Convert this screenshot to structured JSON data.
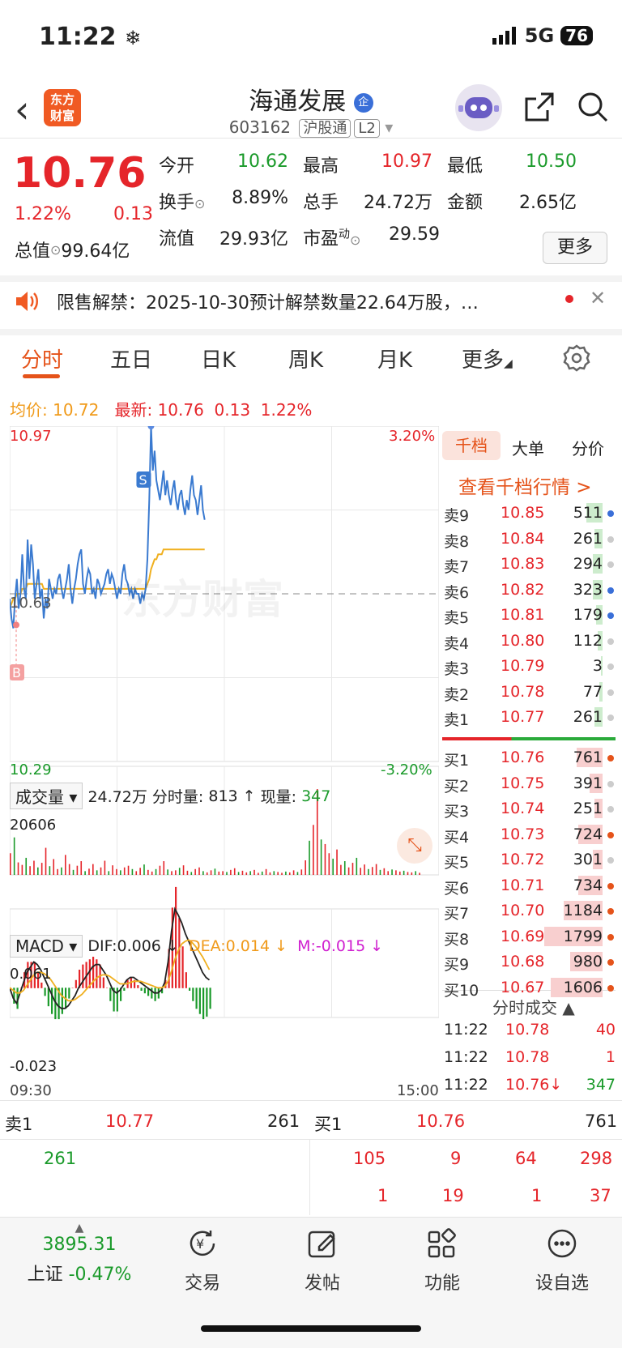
{
  "status": {
    "time": "11:22",
    "network": "5G",
    "battery": "76"
  },
  "header": {
    "logo_line1": "东方",
    "logo_line2": "财富",
    "name": "海通发展",
    "name_badge": "企",
    "code": "603162",
    "tag1": "沪股通",
    "tag2": "L2"
  },
  "quote": {
    "price": "10.76",
    "chg_pct": "1.22%",
    "chg_amt": "0.13",
    "open_label": "今开",
    "open": "10.62",
    "high_label": "最高",
    "high": "10.97",
    "low_label": "最低",
    "low": "10.50",
    "turnover_label": "换手",
    "turnover": "8.89%",
    "volume_label": "总手",
    "volume": "24.72万",
    "amount_label": "金额",
    "amount": "2.65亿",
    "total_val_label": "总值",
    "total_val": "99.64亿",
    "float_val_label": "流值",
    "float_val": "29.93亿",
    "pe_label": "市盈",
    "pe_sup": "动",
    "pe": "29.59",
    "more": "更多"
  },
  "notice": {
    "text": "限售解禁：2025-10-30预计解禁数量22.64万股，…"
  },
  "tabs": [
    "分时",
    "五日",
    "日K",
    "周K",
    "月K",
    "更多"
  ],
  "avg_bar": {
    "avg_label": "均价:",
    "avg": "10.72",
    "latest_label": "最新:",
    "latest": "10.76",
    "chg": "0.13",
    "pct": "1.22%"
  },
  "chart": {
    "price_high": "10.97",
    "price_low": "10.29",
    "pct_high": "3.20%",
    "pct_low": "-3.20%",
    "base_price": "10.63",
    "watermark": "东方财富",
    "b_marker": "B",
    "s_marker": "S",
    "time_start": "09:30",
    "time_end": "15:00"
  },
  "volume_bar": {
    "label": "成交量",
    "total": "24.72万",
    "tick_label": "分时量:",
    "tick": "813",
    "now_label": "现量:",
    "now": "347",
    "max": "20606"
  },
  "macd_bar": {
    "label": "MACD",
    "dif": "DIF:0.006 ↓",
    "dea": "DEA:0.014 ↓",
    "m": "M:-0.015 ↓",
    "max": "0.061",
    "min": "-0.023"
  },
  "book_tabs": [
    "千档",
    "大单",
    "分价"
  ],
  "book_link": "查看千档行情 >",
  "asks": [
    {
      "label": "卖9",
      "price": "10.85",
      "vol": "511",
      "bar": 0.1,
      "dot": "#3a6fd8"
    },
    {
      "label": "卖8",
      "price": "10.84",
      "vol": "261",
      "bar": 0.05,
      "dot": "#cccccc"
    },
    {
      "label": "卖7",
      "price": "10.83",
      "vol": "294",
      "bar": 0.06,
      "dot": "#cccccc"
    },
    {
      "label": "卖6",
      "price": "10.82",
      "vol": "323",
      "bar": 0.06,
      "dot": "#3a6fd8"
    },
    {
      "label": "卖5",
      "price": "10.81",
      "vol": "179",
      "bar": 0.04,
      "dot": "#3a6fd8"
    },
    {
      "label": "卖4",
      "price": "10.80",
      "vol": "112",
      "bar": 0.03,
      "dot": "#cccccc"
    },
    {
      "label": "卖3",
      "price": "10.79",
      "vol": "3",
      "bar": 0.01,
      "dot": "#cccccc"
    },
    {
      "label": "卖2",
      "price": "10.78",
      "vol": "77",
      "bar": 0.02,
      "dot": "#cccccc"
    },
    {
      "label": "卖1",
      "price": "10.77",
      "vol": "261",
      "bar": 0.05,
      "dot": "#cccccc"
    }
  ],
  "bids": [
    {
      "label": "买1",
      "price": "10.76",
      "vol": "761",
      "bar": 0.16,
      "dot": "#e5531a"
    },
    {
      "label": "买2",
      "price": "10.75",
      "vol": "391",
      "bar": 0.08,
      "dot": "#cccccc"
    },
    {
      "label": "买3",
      "price": "10.74",
      "vol": "251",
      "bar": 0.05,
      "dot": "#cccccc"
    },
    {
      "label": "买4",
      "price": "10.73",
      "vol": "724",
      "bar": 0.15,
      "dot": "#e5531a"
    },
    {
      "label": "买5",
      "price": "10.72",
      "vol": "301",
      "bar": 0.06,
      "dot": "#cccccc"
    },
    {
      "label": "买6",
      "price": "10.71",
      "vol": "734",
      "bar": 0.15,
      "dot": "#e5531a"
    },
    {
      "label": "买7",
      "price": "10.70",
      "vol": "1184",
      "bar": 0.24,
      "dot": "#e5531a"
    },
    {
      "label": "买8",
      "price": "10.69",
      "vol": "1799",
      "bar": 0.36,
      "dot": "#e5531a"
    },
    {
      "label": "买9",
      "price": "10.68",
      "vol": "980",
      "bar": 0.2,
      "dot": "#e5531a"
    },
    {
      "label": "买10",
      "price": "10.67",
      "vol": "1606",
      "bar": 0.32,
      "dot": "#e5531a"
    }
  ],
  "ticks_header": "分时成交 ▲",
  "ticks": [
    {
      "time": "11:22",
      "price": "10.78",
      "vol": "40"
    },
    {
      "time": "11:22",
      "price": "10.78",
      "vol": "1"
    },
    {
      "time": "11:22",
      "price": "10.76↓",
      "vol": "347"
    }
  ],
  "bottom_book": {
    "ask_label": "卖1",
    "ask_price": "10.77",
    "ask_vol": "261",
    "bid_label": "买1",
    "bid_price": "10.76",
    "bid_vol": "761",
    "ask_queue": [
      "261"
    ],
    "bid_queue_row1": [
      "105",
      "9",
      "64",
      "298"
    ],
    "bid_queue_row2": [
      "1",
      "19",
      "1",
      "37"
    ]
  },
  "nav": {
    "index_value": "3895.31",
    "index_name": "上证",
    "index_pct": "-0.47%",
    "items": [
      "交易",
      "发帖",
      "功能",
      "设自选"
    ]
  },
  "chart_data": [
    {
      "type": "line",
      "title": "",
      "ylim": [
        10.29,
        10.97
      ],
      "series": [
        {
          "values": [
            10.62,
            10.58,
            10.56,
            10.62,
            10.66,
            10.6,
            10.63,
            10.71,
            10.64,
            10.62,
            10.74,
            10.66,
            10.73,
            10.69,
            10.62,
            10.65,
            10.68,
            10.62,
            10.64,
            10.58,
            10.62,
            10.6,
            10.66,
            10.64,
            10.62,
            10.64,
            10.63,
            10.66,
            10.67,
            10.64,
            10.62,
            10.64,
            10.66,
            10.69,
            10.64,
            10.61,
            10.64,
            10.66,
            10.69,
            10.71,
            10.72,
            10.65,
            10.63,
            10.66,
            10.68,
            10.67,
            10.63,
            10.64,
            10.62,
            10.66,
            10.65,
            10.63,
            10.64,
            10.65,
            10.67,
            10.68,
            10.65,
            10.67,
            10.66,
            10.64,
            10.62,
            10.64,
            10.63,
            10.67,
            10.69,
            10.66,
            10.65,
            10.63,
            10.64,
            10.62,
            10.64,
            10.63,
            10.63,
            10.61,
            10.63,
            10.62,
            10.64,
            10.7,
            10.82,
            10.97,
            10.88,
            10.92,
            10.86,
            10.84,
            10.82,
            10.85,
            10.88,
            10.83,
            10.86,
            10.83,
            10.81,
            10.84,
            10.86,
            10.82,
            10.8,
            10.83,
            10.84,
            10.81,
            10.79,
            10.82,
            10.8,
            10.84,
            10.87,
            10.83,
            10.82,
            10.79,
            10.82,
            10.85,
            10.8,
            10.78
          ]
        },
        {
          "values": [
            10.6,
            10.61,
            10.62,
            10.62,
            10.63,
            10.63,
            10.63,
            10.64,
            10.64,
            10.64,
            10.65,
            10.65,
            10.65,
            10.65,
            10.65,
            10.65,
            10.65,
            10.65,
            10.65,
            10.64,
            10.64,
            10.64,
            10.64,
            10.64,
            10.64,
            10.64,
            10.64,
            10.64,
            10.64,
            10.64,
            10.64,
            10.64,
            10.64,
            10.64,
            10.64,
            10.64,
            10.64,
            10.64,
            10.64,
            10.64,
            10.64,
            10.64,
            10.64,
            10.64,
            10.64,
            10.64,
            10.64,
            10.64,
            10.64,
            10.64,
            10.64,
            10.64,
            10.64,
            10.64,
            10.64,
            10.64,
            10.64,
            10.64,
            10.64,
            10.64,
            10.64,
            10.64,
            10.64,
            10.64,
            10.64,
            10.64,
            10.64,
            10.64,
            10.64,
            10.64,
            10.64,
            10.64,
            10.64,
            10.64,
            10.64,
            10.64,
            10.64,
            10.65,
            10.66,
            10.68,
            10.69,
            10.7,
            10.7,
            10.71,
            10.71,
            10.71,
            10.72,
            10.72,
            10.72,
            10.72,
            10.72,
            10.72,
            10.72,
            10.72,
            10.72,
            10.72,
            10.72,
            10.72,
            10.72,
            10.72,
            10.72,
            10.72,
            10.72,
            10.72,
            10.72,
            10.72,
            10.72,
            10.72,
            10.72,
            10.72
          ]
        }
      ]
    },
    {
      "type": "bar",
      "title": "成交量",
      "ylim": [
        0,
        20606
      ],
      "values": [
        5200,
        9000,
        3000,
        2400,
        4100,
        2100,
        3400,
        1800,
        2900,
        6500,
        2100,
        3800,
        1400,
        1800,
        4800,
        2600,
        1200,
        2200,
        3300,
        900,
        1500,
        2600,
        1100,
        1800,
        3400,
        900,
        2300,
        1400,
        1100,
        1800,
        2200,
        1400,
        900,
        1700,
        2500,
        1200,
        800,
        1400,
        2200,
        3300,
        1300,
        900,
        1100,
        1700,
        2300,
        1000,
        700,
        1400,
        1800,
        900,
        600,
        1100,
        1500,
        800,
        900,
        700,
        1200,
        1600,
        700,
        1000,
        600,
        900,
        1200,
        500,
        800,
        1400,
        600,
        900,
        700,
        500,
        800,
        600,
        1100,
        700,
        1300,
        3500,
        8200,
        12000,
        20606,
        8500,
        7400,
        5200,
        3900,
        6100,
        2400,
        3300,
        1800,
        2900,
        4100,
        1700,
        2500,
        1400,
        1900,
        2600,
        1200,
        1600,
        900,
        1300,
        1100,
        800,
        1000,
        700,
        600,
        900,
        500
      ]
    },
    {
      "type": "line",
      "title": "MACD",
      "ylim": [
        -0.023,
        0.061
      ],
      "series": [
        {
          "name": "DIF",
          "values": [
            0.0,
            -0.008,
            -0.012,
            -0.004,
            0.004,
            0.012,
            0.016,
            0.02,
            0.018,
            0.014,
            0.008,
            0.002,
            -0.004,
            -0.01,
            -0.014,
            -0.016,
            -0.016,
            -0.014,
            -0.01,
            -0.006,
            0.0,
            0.004,
            0.008,
            0.012,
            0.016,
            0.018,
            0.018,
            0.014,
            0.01,
            0.004,
            -0.002,
            -0.004,
            -0.002,
            0.002,
            0.006,
            0.008,
            0.008,
            0.006,
            0.004,
            0.002,
            0.0,
            -0.002,
            -0.004,
            -0.004,
            -0.002,
            0.004,
            0.02,
            0.044,
            0.061,
            0.056,
            0.05,
            0.042,
            0.036,
            0.03,
            0.024,
            0.018,
            0.012,
            0.008,
            0.006
          ]
        },
        {
          "name": "DEA",
          "values": [
            0.0,
            -0.002,
            -0.004,
            -0.004,
            -0.002,
            0.002,
            0.006,
            0.01,
            0.012,
            0.012,
            0.011,
            0.009,
            0.006,
            0.002,
            -0.002,
            -0.006,
            -0.008,
            -0.01,
            -0.01,
            -0.009,
            -0.007,
            -0.005,
            -0.002,
            0.001,
            0.004,
            0.007,
            0.009,
            0.01,
            0.01,
            0.009,
            0.007,
            0.005,
            0.003,
            0.003,
            0.003,
            0.004,
            0.005,
            0.005,
            0.005,
            0.004,
            0.003,
            0.002,
            0.001,
            0.0,
            0.0,
            0.001,
            0.005,
            0.013,
            0.022,
            0.029,
            0.034,
            0.036,
            0.037,
            0.035,
            0.032,
            0.028,
            0.024,
            0.019,
            0.014
          ]
        }
      ]
    }
  ]
}
